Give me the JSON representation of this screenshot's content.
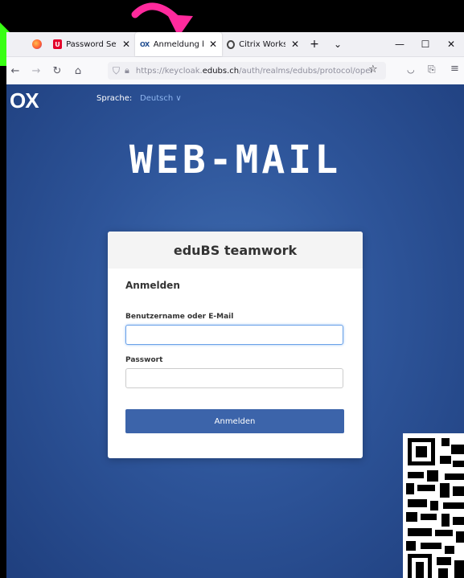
{
  "browser": {
    "tabs": [
      {
        "title": "Password Settin",
        "icon": "u-logo"
      },
      {
        "title": "Anmeldung bei",
        "icon": "ox-logo",
        "active": true
      },
      {
        "title": "Citrix Workspace",
        "icon": "citrix-icon"
      }
    ],
    "url_prefix": "https://keycloak.",
    "url_host": "edubs.ch",
    "url_path": "/auth/realms/edubs/protocol/oper"
  },
  "page": {
    "logo": "OX",
    "language_label": "Sprache:",
    "language_value": "Deutsch ∨",
    "banner": "WEB-MAIL",
    "card": {
      "title": "eduBS teamwork",
      "heading": "Anmelden",
      "username_label": "Benutzername oder E-Mail",
      "username_value": "",
      "password_label": "Passwort",
      "password_value": "",
      "submit_label": "Anmelden"
    }
  },
  "colors": {
    "accent": "#3c64aa",
    "link": "#8fb6f0",
    "arrow": "#ff2a9d",
    "green": "#39ff14"
  }
}
